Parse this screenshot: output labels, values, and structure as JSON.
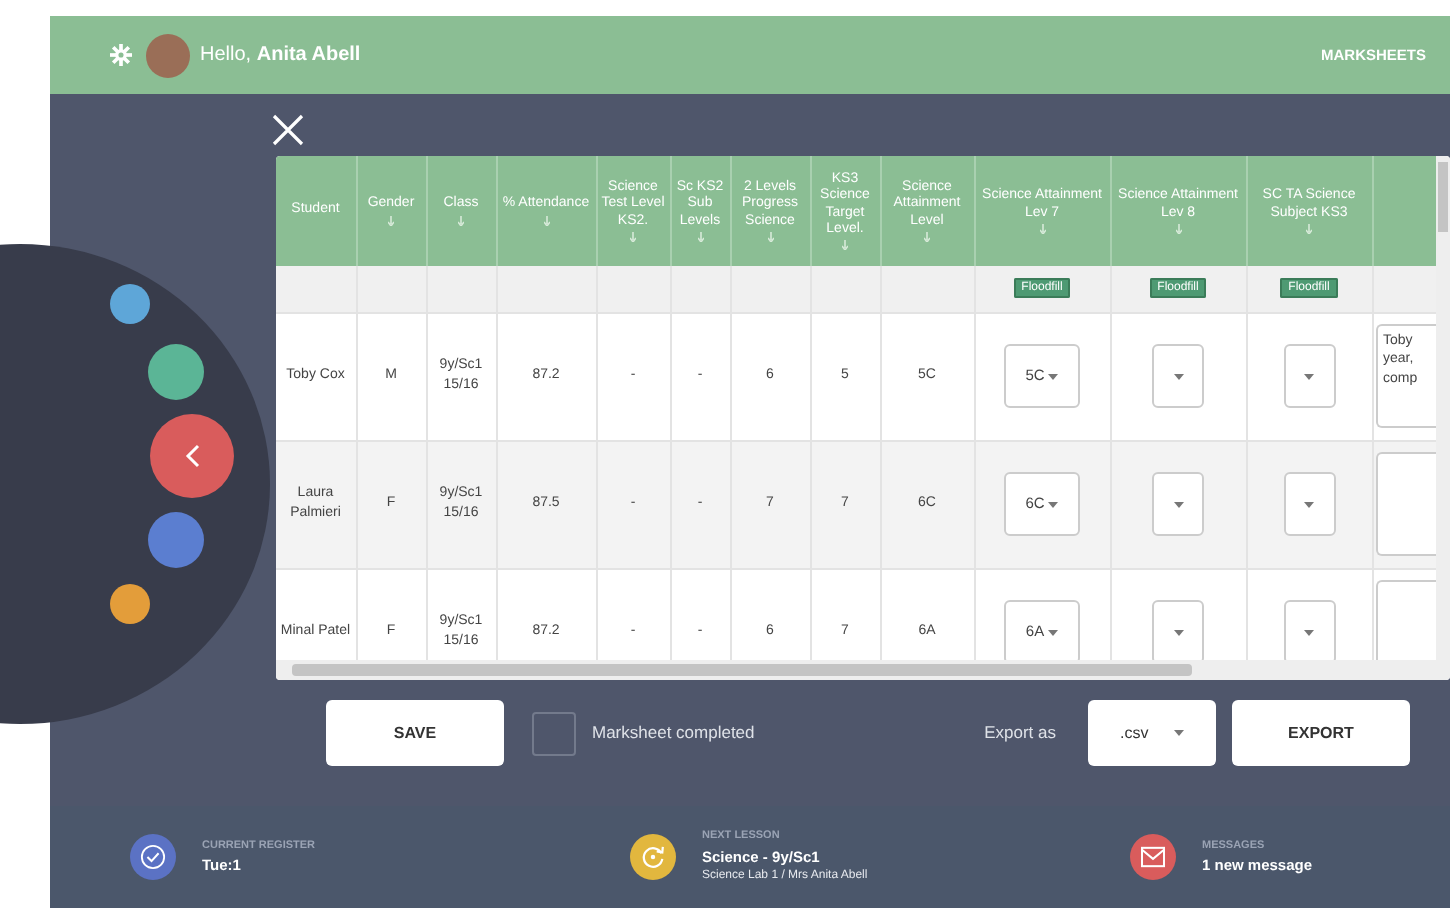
{
  "header": {
    "greeting": "Hello, **Anita Abell**",
    "nav_link": "MARKSHEETS"
  },
  "side_nav": [
    {
      "color": "#5ea6d8",
      "selected": false
    },
    {
      "color": "#5bb596",
      "selected": false
    },
    {
      "color": "#d95c5c",
      "selected": true
    },
    {
      "color": "#5b7ed0",
      "selected": false
    },
    {
      "color": "#e39d3a",
      "selected": false
    }
  ],
  "table": {
    "columns": [
      {
        "label": "Student",
        "sort": false
      },
      {
        "label": "Gender",
        "sort": true
      },
      {
        "label": "Class",
        "sort": true
      },
      {
        "label": "% Attendance",
        "sort": true
      },
      {
        "label": "Science Test Level KS2.",
        "sort": true
      },
      {
        "label": "Sc KS2 Sub Levels",
        "sort": true
      },
      {
        "label": "2 Levels Progress Science",
        "sort": true
      },
      {
        "label": "KS3 Science Target Level.",
        "sort": true
      },
      {
        "label": "Science Attainment Level",
        "sort": true
      },
      {
        "label": "Science Attainment Lev 7",
        "sort": true,
        "floodfill": "Floodfill"
      },
      {
        "label": "Science Attainment Lev 8",
        "sort": true,
        "floodfill": "Floodfill"
      },
      {
        "label": "SC TA Science Subject KS3",
        "sort": true,
        "floodfill": "Floodfill"
      },
      {
        "sort": false
      }
    ],
    "rows": [
      {
        "cells": [
          "Toby Cox",
          "M",
          "9y/Sc1 15/16",
          "87.2",
          "-",
          "-",
          "6",
          "5",
          "5C"
        ],
        "select_values": [
          "5C"
        ],
        "comment": "Toby\nyear,\ncomp"
      },
      {
        "cells": [
          "Laura Palmieri",
          "F",
          "9y/Sc1 15/16",
          "87.5",
          "-",
          "-",
          "7",
          "7",
          "6C"
        ],
        "select_values": [
          "6C"
        ]
      },
      {
        "cells": [
          "Minal Patel",
          "F",
          "9y/Sc1 15/16",
          "87.2",
          "-",
          "-",
          "6",
          "7",
          "6A"
        ],
        "select_values": [
          "6A"
        ]
      }
    ]
  },
  "actions": {
    "save": "SAVE",
    "completed": {
      "label": "Marksheet completed",
      "checked": false
    },
    "export_label": "Export as",
    "format": ".csv",
    "export": "EXPORT"
  },
  "footer": [
    {
      "kind": "register",
      "color": "#5b72c4",
      "label": "CURRENT REGISTER",
      "value": "Tue:1"
    },
    {
      "kind": "lesson",
      "color": "#e2b73e",
      "label": "NEXT LESSON",
      "value": "Science - 9y/Sc1",
      "detail": "Science Lab 1 / Mrs Anita Abell"
    },
    {
      "kind": "messages",
      "color": "#d95c5c",
      "label": "MESSAGES",
      "value": "1 new message"
    }
  ]
}
